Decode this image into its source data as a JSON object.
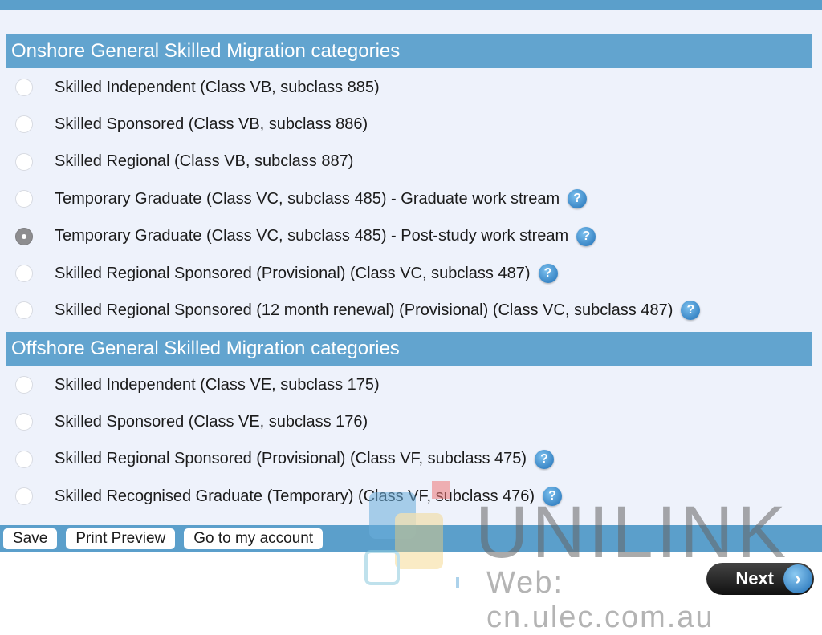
{
  "onshore": {
    "title": "Onshore General Skilled Migration categories",
    "items": [
      {
        "label": "Skilled Independent (Class VB, subclass 885)",
        "checked": false,
        "help": false
      },
      {
        "label": "Skilled Sponsored (Class VB, subclass 886)",
        "checked": false,
        "help": false
      },
      {
        "label": "Skilled Regional (Class VB, subclass 887)",
        "checked": false,
        "help": false
      },
      {
        "label": "Temporary Graduate (Class VC, subclass 485) - Graduate work stream",
        "checked": false,
        "help": true
      },
      {
        "label": "Temporary Graduate (Class VC, subclass 485) - Post-study work stream",
        "checked": true,
        "help": true
      },
      {
        "label": "Skilled Regional Sponsored (Provisional) (Class VC, subclass 487)",
        "checked": false,
        "help": true
      },
      {
        "label": "Skilled Regional Sponsored (12 month renewal) (Provisional) (Class VC, subclass 487)",
        "checked": false,
        "help": true
      }
    ]
  },
  "offshore": {
    "title": "Offshore General Skilled Migration categories",
    "items": [
      {
        "label": "Skilled Independent (Class VE, subclass 175)",
        "checked": false,
        "help": false
      },
      {
        "label": "Skilled Sponsored (Class VE, subclass 176)",
        "checked": false,
        "help": false
      },
      {
        "label": "Skilled Regional Sponsored (Provisional) (Class VF, subclass 475)",
        "checked": false,
        "help": true
      },
      {
        "label": "Skilled Recognised Graduate (Temporary) (Class VF, subclass 476)",
        "checked": false,
        "help": true
      }
    ]
  },
  "help_icon": "?",
  "toolbar": {
    "save": "Save",
    "print_preview": "Print Preview",
    "account": "Go to my account"
  },
  "next": {
    "label": "Next",
    "icon": "chevron-right-icon",
    "arrow": "›"
  },
  "watermark": {
    "brand": "UNILINK",
    "web": "Web: cn.ulec.com.au"
  },
  "colors": {
    "accent": "#5b9fcb",
    "header": "#62a4cf",
    "panel": "#eef2fb"
  }
}
